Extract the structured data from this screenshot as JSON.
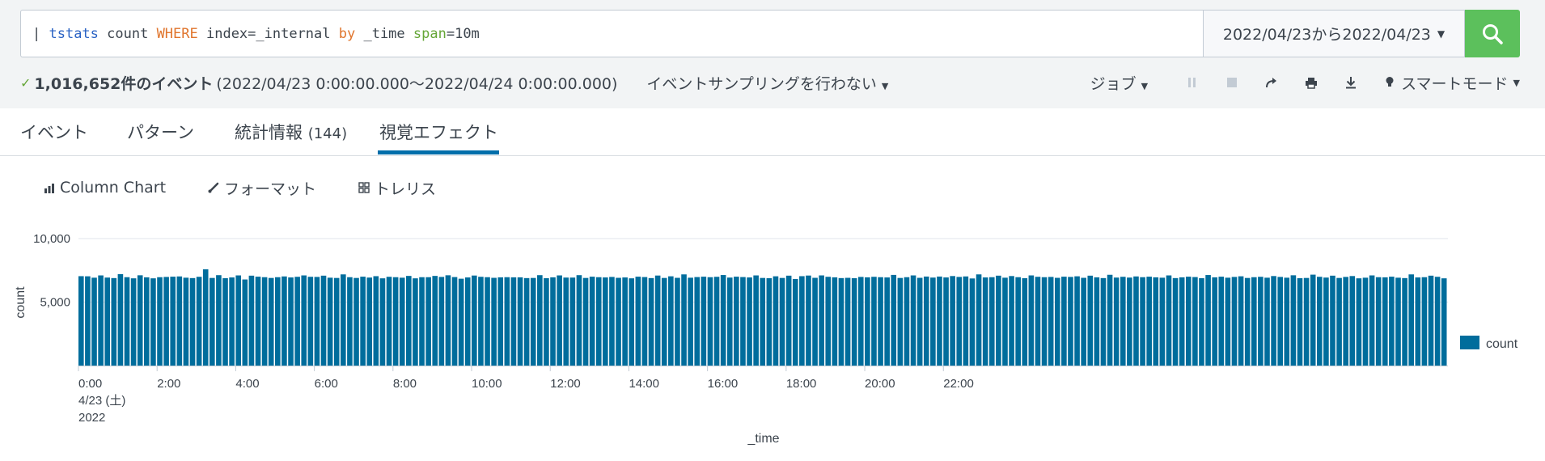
{
  "search": {
    "pipe": "| ",
    "command": "tstats",
    "t1": " count ",
    "where": "WHERE",
    "t2": " index=_internal ",
    "by": "by",
    "t3": " _time ",
    "span_kw": "span",
    "t4": "=10m"
  },
  "time_picker": {
    "label": "2022/04/23から2022/04/23"
  },
  "status": {
    "event_count": "1,016,652件のイベント",
    "range": "(2022/04/23 0:00:00.000～2022/04/24 0:00:00.000)",
    "sampling": "イベントサンプリングを行わない",
    "job": "ジョブ",
    "mode": "スマートモード"
  },
  "tabs": [
    {
      "label": "イベント"
    },
    {
      "label": "パターン"
    },
    {
      "label": "統計情報",
      "count": "(144)"
    },
    {
      "label": "視覚エフェクト"
    }
  ],
  "chart_toolbar": {
    "chart_type": "Column Chart",
    "format": "フォーマット",
    "trellis": "トレリス"
  },
  "colors": {
    "bar": "#006d9c",
    "search_button": "#5cc05c",
    "tab_underline": "#006eaa"
  },
  "chart_data": {
    "type": "bar",
    "xlabel": "_time",
    "ylabel": "count",
    "ylim": [
      0,
      10000
    ],
    "y_ticks": [
      "10,000",
      "5,000"
    ],
    "x_ticks": [
      "0:00",
      "2:00",
      "4:00",
      "6:00",
      "8:00",
      "10:00",
      "12:00",
      "14:00",
      "16:00",
      "18:00",
      "20:00",
      "22:00"
    ],
    "x_first_tick_extra": [
      "4/23 (土)",
      "2022"
    ],
    "legend": [
      "count"
    ],
    "series": [
      {
        "name": "count",
        "values": [
          7040,
          7030,
          6920,
          7100,
          6930,
          6890,
          7200,
          6960,
          6870,
          7110,
          6950,
          6870,
          6960,
          6980,
          7000,
          7020,
          6920,
          6890,
          6990,
          7580,
          6900,
          7120,
          6880,
          6940,
          7100,
          6780,
          7080,
          7000,
          6960,
          6900,
          6960,
          7020,
          6940,
          6990,
          7100,
          6990,
          6980,
          7080,
          6920,
          6900,
          7180,
          6960,
          6900,
          7000,
          6930,
          7040,
          6870,
          6990,
          6960,
          6920,
          7060,
          6870,
          6960,
          6960,
          7060,
          6980,
          7110,
          6970,
          6840,
          6940,
          7090,
          6990,
          6960,
          6910,
          6950,
          6960,
          6950,
          6950,
          6890,
          6900,
          7120,
          6880,
          6950,
          7100,
          6930,
          6930,
          7120,
          6900,
          7000,
          6960,
          6940,
          6980,
          6910,
          6940,
          6870,
          7000,
          6970,
          6890,
          7090,
          6900,
          7030,
          6910,
          7180,
          6920,
          6970,
          7000,
          6960,
          6990,
          7130,
          6930,
          7000,
          6970,
          6940,
          7100,
          6900,
          6880,
          7030,
          6900,
          7080,
          6820,
          7040,
          7090,
          6910,
          7100,
          6990,
          6950,
          6890,
          6910,
          6880,
          6980,
          6950,
          6990,
          6960,
          6940,
          7140,
          6900,
          6960,
          7100,
          6910,
          7010,
          6930,
          7010,
          6940,
          7050,
          6980,
          7020,
          6860,
          7180,
          6940,
          6960,
          7080,
          6920,
          7050,
          6960,
          6880,
          7100,
          6990,
          6960,
          6980,
          6910,
          7000,
          6980,
          7030,
          6910,
          7080,
          6950,
          6890,
          7150,
          6930,
          6990,
          6930,
          7020,
          6960,
          7000,
          6950,
          6920,
          7100,
          6890,
          6950,
          7000,
          6970,
          6880,
          7130,
          6950,
          7000,
          6920,
          6980,
          7030,
          6900,
          6960,
          6990,
          6920,
          7050,
          6980,
          6920,
          7110,
          6880,
          6900,
          7160,
          6990,
          6930,
          7080,
          6900,
          6980,
          7050,
          6870,
          6920,
          7100,
          6960,
          6950,
          7000,
          6920,
          6890,
          7180,
          6940,
          6960,
          7080,
          6990,
          6870
        ]
      }
    ]
  }
}
